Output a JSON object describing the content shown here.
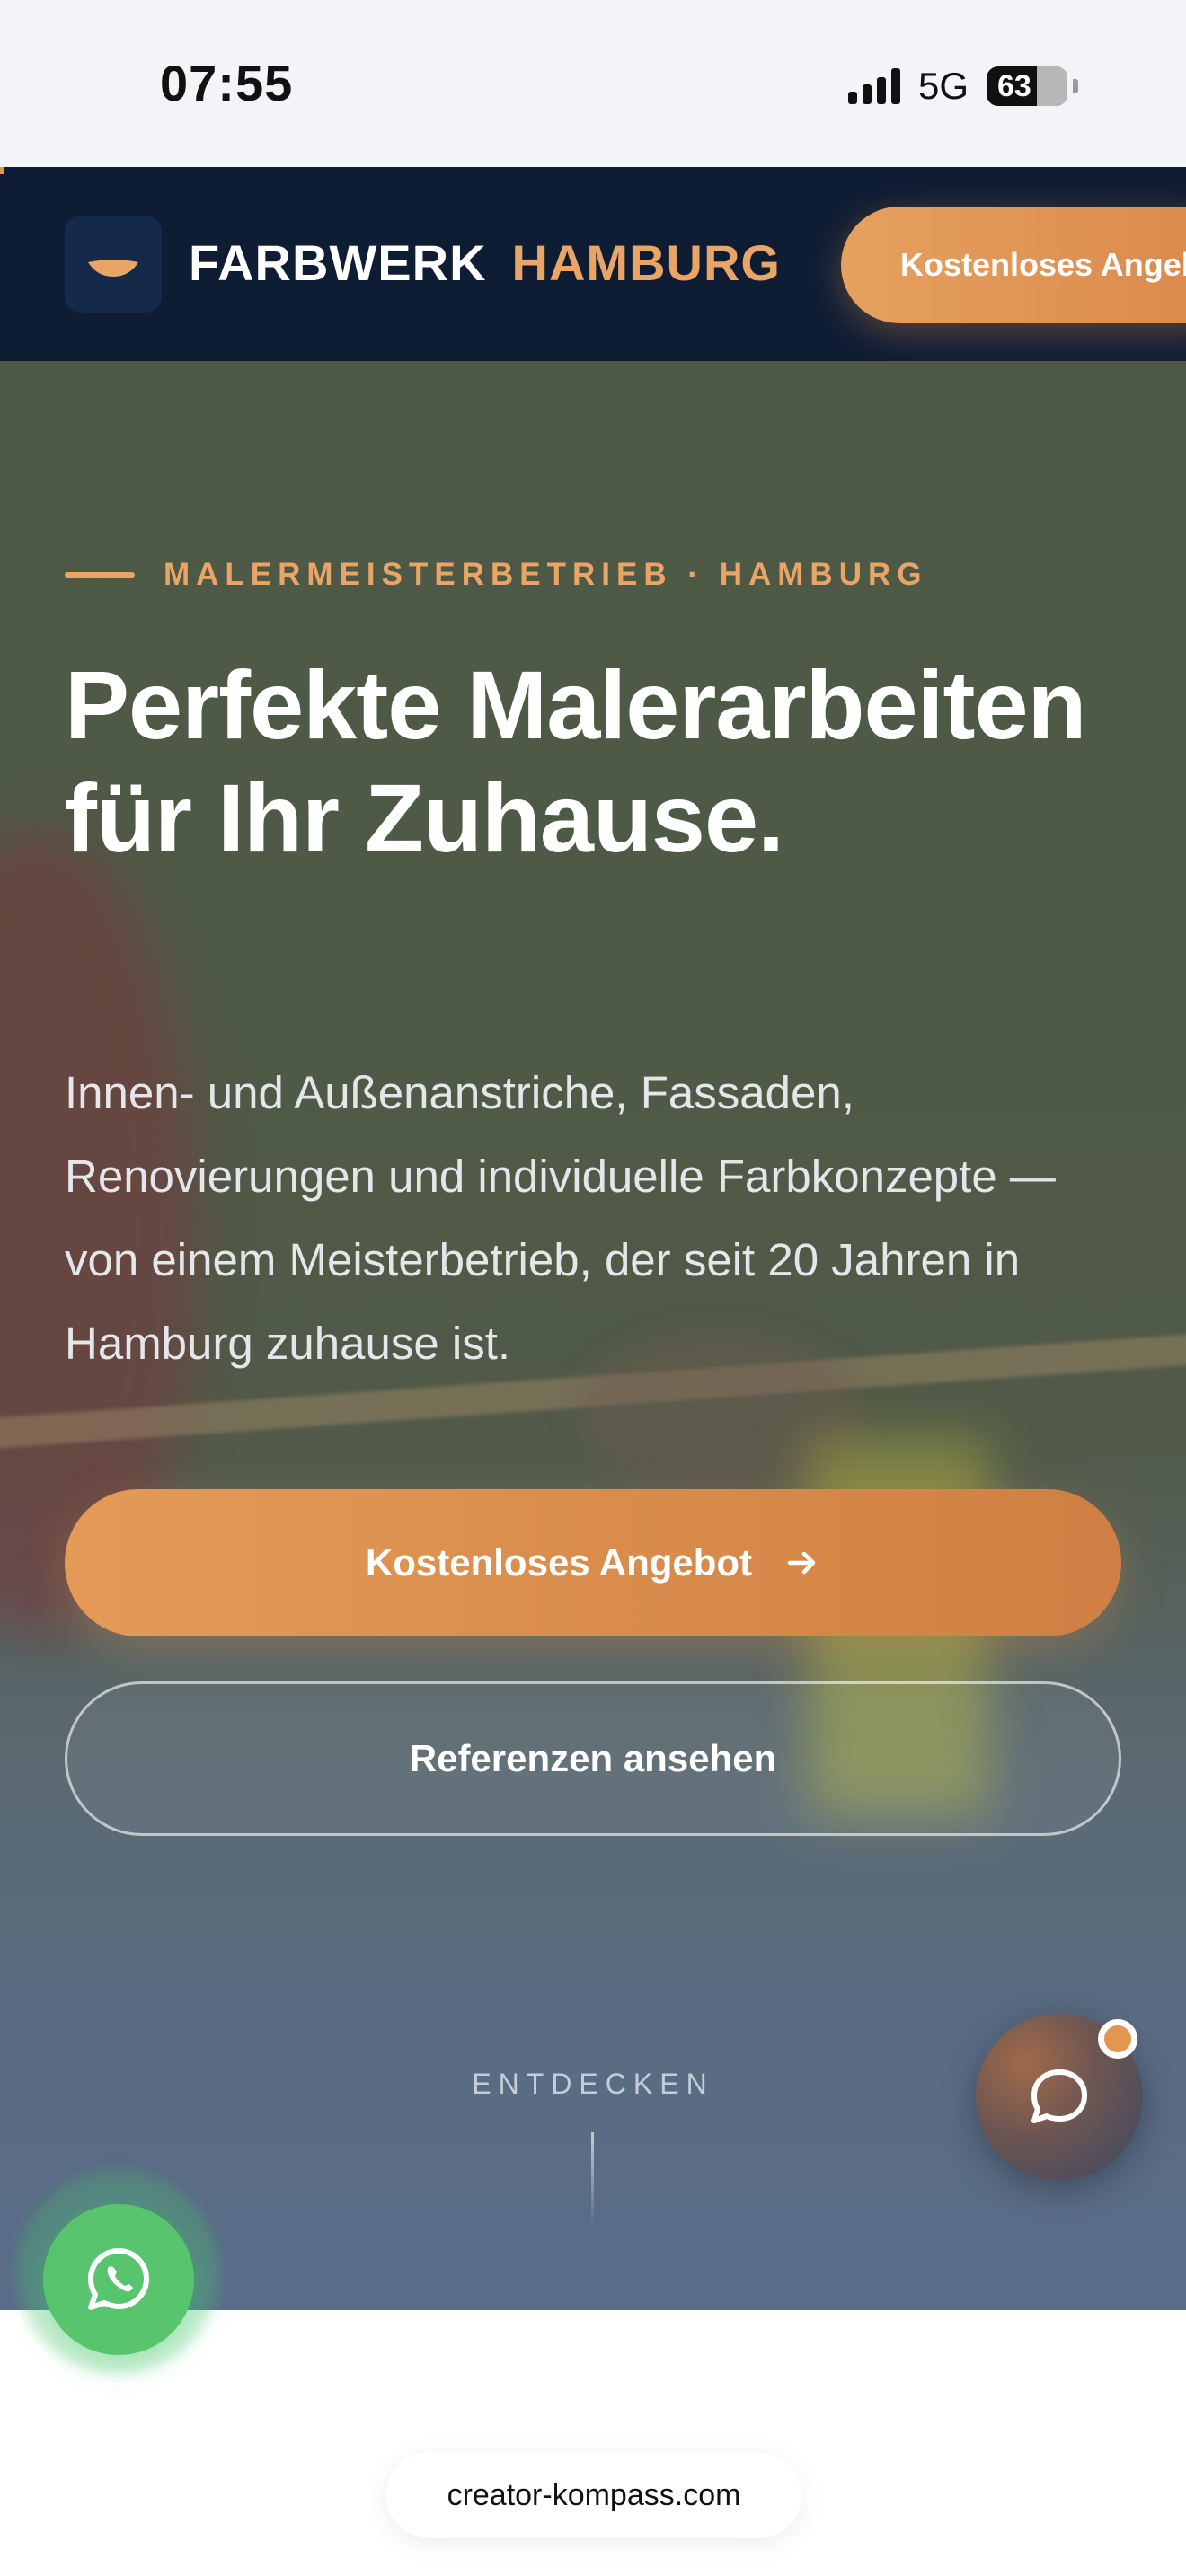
{
  "status_bar": {
    "time": "07:55",
    "network": "5G",
    "battery": "63"
  },
  "header": {
    "brand_primary": "FARBWERK",
    "brand_secondary": "HAMBURG",
    "cta_label": "Kostenloses Angebot",
    "logo_icon": "paint-drop-icon"
  },
  "hero": {
    "eyebrow": "MALERMEISTERBETRIEB · HAMBURG",
    "title": "Perfekte Malerarbeiten für Ihr Zuhause.",
    "text": "Innen- und Außenanstriche, Fassaden, Renovierungen und individuelle Farbkonzepte — von einem Meisterbetrieb, der seit 20 Jahren in Hamburg zuhause ist.",
    "primary_button": "Kostenloses Angebot",
    "secondary_button": "Referenzen ansehen",
    "discover": "ENTDECKEN"
  },
  "floating": {
    "chat_icon": "chat-bubble-icon",
    "whatsapp_icon": "whatsapp-icon"
  },
  "browser": {
    "url": "creator-kompass.com"
  },
  "colors": {
    "accent": "#e8a565",
    "header_bg": "#0e1c34",
    "whatsapp": "#58c46e"
  }
}
